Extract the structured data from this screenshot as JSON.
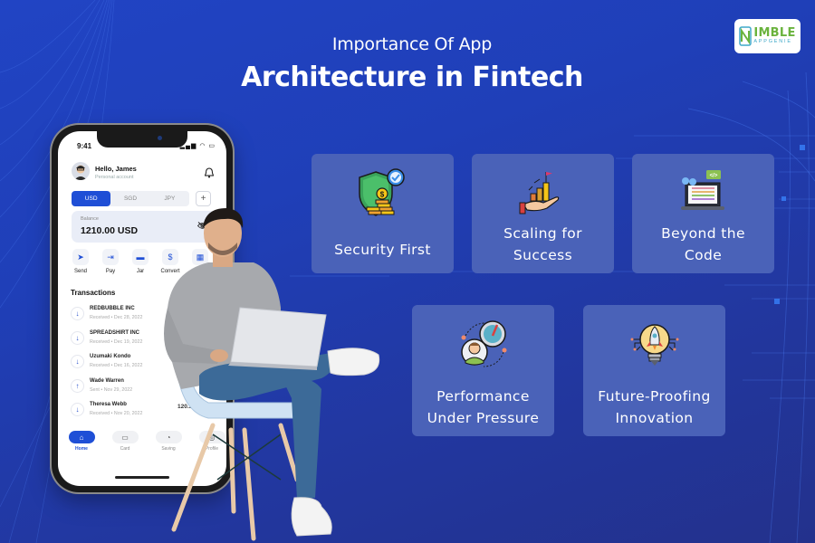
{
  "header": {
    "subtitle": "Importance Of App",
    "title": "Architecture in Fintech"
  },
  "logo": {
    "main": "IMBLE",
    "sub": "APPGENIE",
    "brand_colors": {
      "green": "#6ab33e",
      "teal": "#3fa9c9"
    }
  },
  "cards": [
    {
      "label_lines": [
        "Security First"
      ],
      "icon": "shield-coins-icon"
    },
    {
      "label_lines": [
        "Scaling for",
        "Success"
      ],
      "icon": "hand-growth-chart-icon"
    },
    {
      "label_lines": [
        "Beyond the",
        "Code"
      ],
      "icon": "laptop-code-icon"
    },
    {
      "label_lines": [
        "Performance",
        "Under Pressure"
      ],
      "icon": "gauge-person-icon"
    },
    {
      "label_lines": [
        "Future-Proofing",
        "Innovation"
      ],
      "icon": "bulb-rocket-icon"
    }
  ],
  "phone": {
    "status_time": "9:41",
    "status_icons": "▂▄▆ ◠ ▭",
    "greeting": "Hello, James",
    "account_type": "Personal account",
    "currencies": [
      "USD",
      "SGD",
      "JPY"
    ],
    "active_currency": "USD",
    "add_currency": "+",
    "balance_label": "Balance",
    "balance_value": "1210.00 USD",
    "actions": [
      {
        "label": "Send",
        "icon": "➤"
      },
      {
        "label": "Pay",
        "icon": "⇥"
      },
      {
        "label": "Jar",
        "icon": "▬"
      },
      {
        "label": "Convert",
        "icon": "$"
      },
      {
        "label": "QR",
        "icon": "▦"
      }
    ],
    "transactions_title": "Transactions",
    "transactions": [
      {
        "name": "REDBUBBLE INC",
        "meta": "Received • Dec 28, 2022",
        "direction": "↓",
        "amount": ""
      },
      {
        "name": "SPREADSHIRT INC",
        "meta": "Received • Dec 19, 2022",
        "direction": "↓",
        "amount": ""
      },
      {
        "name": "Uzumaki Kondo",
        "meta": "Received • Dec 16, 2022",
        "direction": "↓",
        "amount": ""
      },
      {
        "name": "Wade Warren",
        "meta": "Sent • Nov 29, 2022",
        "direction": "↑",
        "amount": ""
      },
      {
        "name": "Theresa Webb",
        "meta": "Received • Nov 20, 2022",
        "direction": "↓",
        "amount": "120.5"
      }
    ],
    "nav": [
      {
        "label": "Home",
        "icon": "⌂",
        "active": true
      },
      {
        "label": "Card",
        "icon": "▭",
        "active": false
      },
      {
        "label": "Saving",
        "icon": "◔",
        "active": false
      },
      {
        "label": "Profile",
        "icon": "◎",
        "active": false
      }
    ]
  },
  "colors": {
    "background": "#2040b8",
    "card": "#4a62b8",
    "accent": "#1f4fd6"
  }
}
